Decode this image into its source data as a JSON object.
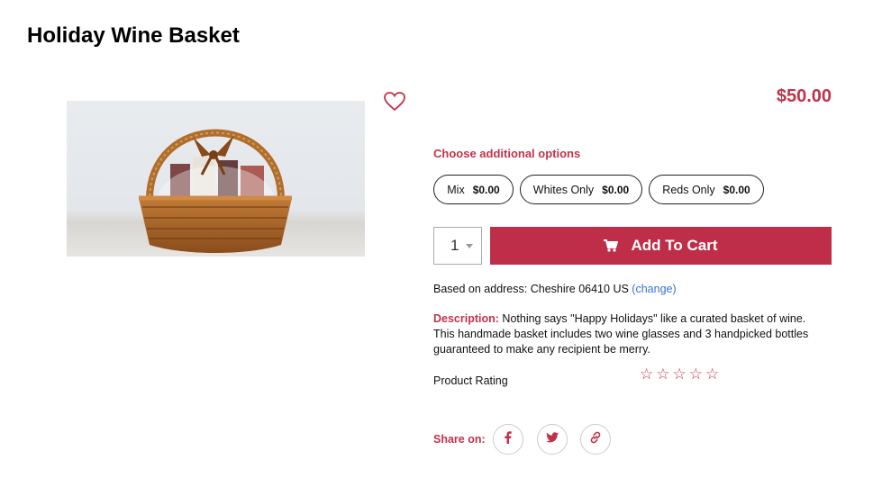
{
  "product": {
    "title": "Holiday Wine Basket",
    "price": "$50.00",
    "image_alt": "Wicker basket with wine bottles and bow"
  },
  "options": {
    "heading": "Choose additional options",
    "items": [
      {
        "label": "Mix",
        "price": "$0.00"
      },
      {
        "label": "Whites Only",
        "price": "$0.00"
      },
      {
        "label": "Reds Only",
        "price": "$0.00"
      }
    ]
  },
  "cart": {
    "quantity": "1",
    "add_label": "Add To Cart"
  },
  "address": {
    "text": "Based on address: Cheshire 06410 US",
    "change_label": "(change)"
  },
  "description": {
    "label": "Description:",
    "text": "Nothing says \"Happy Holidays\" like a curated basket of wine. This handmade basket includes two wine glasses and 3 handpicked bottles guaranteed to make any recipient be merry."
  },
  "rating": {
    "label": "Product Rating",
    "value": 0,
    "max": 5,
    "star_glyph": "☆"
  },
  "share": {
    "label": "Share on:",
    "icons": [
      "facebook-icon",
      "twitter-icon",
      "link-icon"
    ]
  },
  "colors": {
    "accent": "#bf2e49",
    "link": "#3a6fd8"
  }
}
